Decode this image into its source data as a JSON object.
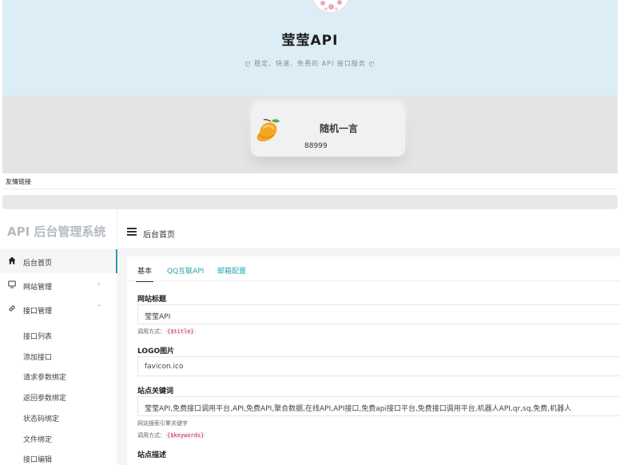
{
  "hero": {
    "title": "莹莹API",
    "subtitle_leaf": "ღ",
    "subtitle": "稳定、快速、免费的 API 接口服务"
  },
  "quote": {
    "title": "随机一言",
    "text": "88999"
  },
  "friend_links": {
    "label": "友情链接"
  },
  "admin": {
    "brand": "API 后台管理系统",
    "breadcrumb": "后台首页",
    "nav": [
      {
        "label": "后台首页",
        "icon": "home-icon"
      },
      {
        "label": "网站管理",
        "icon": "monitor-icon",
        "arrow": "›"
      },
      {
        "label": "接口管理",
        "icon": "link-icon",
        "arrow": "˅"
      }
    ],
    "sub_nav": [
      "接口列表",
      "添加接口",
      "请求参数绑定",
      "返回参数绑定",
      "状态码绑定",
      "文件绑定",
      "接口编辑"
    ],
    "tabs": [
      "基本",
      "QQ互联API",
      "邮箱配置"
    ],
    "fields": {
      "site_title_label": "网站标题",
      "site_title_value": "莹莹API",
      "site_title_hint_prefix": "调用方式：",
      "site_title_hint_code": "{$title}",
      "logo_label": "LOGO图片",
      "logo_value": "favicon.ico",
      "keywords_label": "站点关键词",
      "keywords_value": "莹莹API,免费接口调用平台,API,免费API,聚合数据,在线API,API接口,免费api接口平台,免费接口调用平台,机器人API,qr,sq,免费,机器人",
      "keywords_hint": "网站搜索引擎关键字",
      "keywords_call_prefix": "调用方式：",
      "keywords_call_code": "{$keywords}",
      "description_label": "站点描述"
    }
  },
  "colors": {
    "hero_bg": "#dcedf6",
    "accent": "#2ba3ad",
    "code": "#c7254e"
  }
}
